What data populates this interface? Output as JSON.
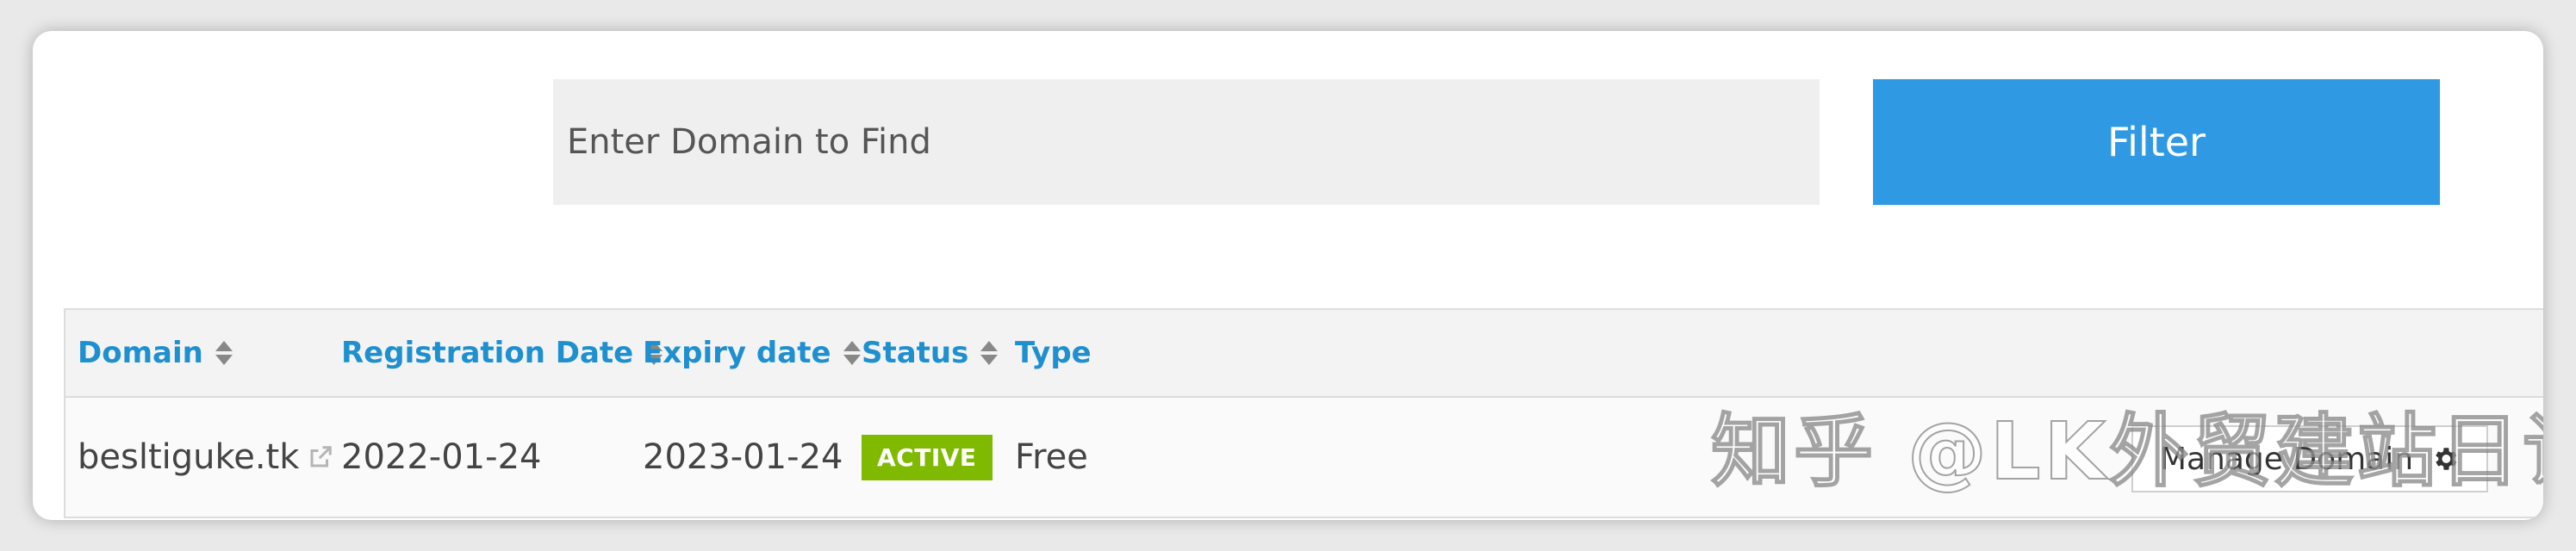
{
  "search": {
    "placeholder": "Enter Domain to Find",
    "filter_label": "Filter"
  },
  "table": {
    "columns": [
      {
        "label": "Domain",
        "sortable": true
      },
      {
        "label": "Registration Date",
        "sortable": true
      },
      {
        "label": "Expiry date",
        "sortable": true
      },
      {
        "label": "Status",
        "sortable": true
      },
      {
        "label": "Type",
        "sortable": false
      }
    ],
    "rows": [
      {
        "domain": "besltiguke.tk",
        "registration_date": "2022-01-24",
        "expiry_date": "2023-01-24",
        "status": "ACTIVE",
        "type": "Free",
        "action_label": "Manage Domain"
      }
    ]
  },
  "watermark": "知乎 @LK外贸建站日记",
  "colors": {
    "accent": "#2f99e3",
    "header_text": "#1e8fcf",
    "status_active": "#7fba00"
  },
  "icons": {
    "external_link": "external-link-icon",
    "sort": "sort-icon",
    "settings": "gear-icon"
  }
}
